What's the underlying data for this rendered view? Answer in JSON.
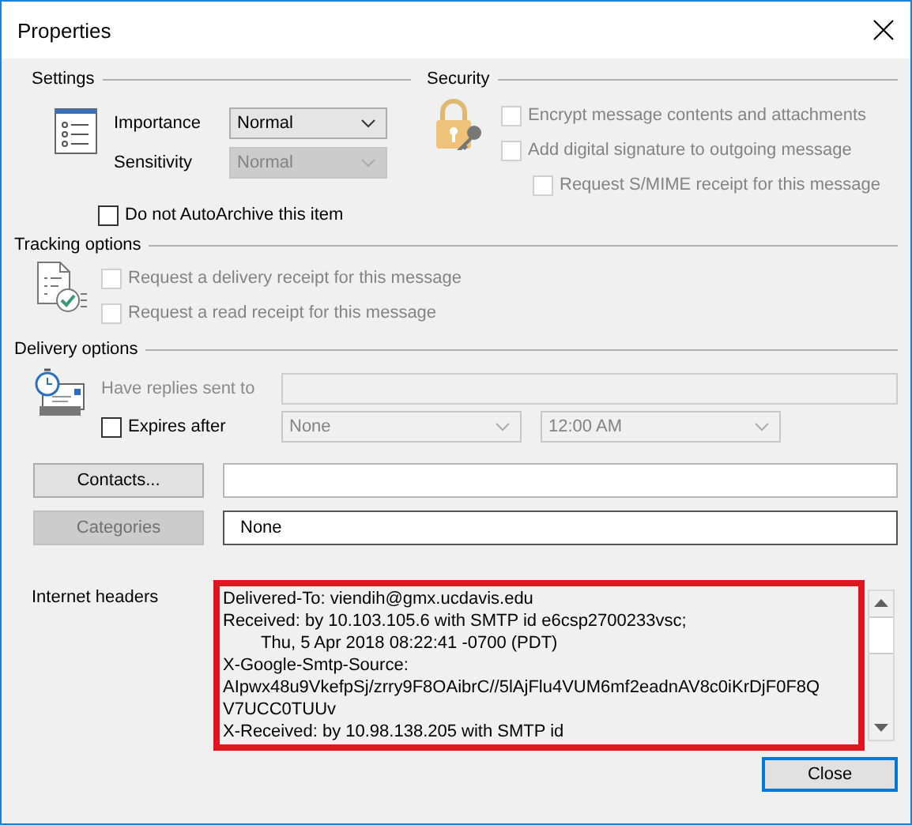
{
  "window": {
    "title": "Properties"
  },
  "settings": {
    "title": "Settings",
    "fields": [
      {
        "label": "Importance",
        "value": "Normal",
        "disabled": false
      },
      {
        "label": "Sensitivity",
        "value": "Normal",
        "disabled": true
      }
    ],
    "autoarchive": {
      "label": "Do not AutoArchive this item",
      "checked": false
    }
  },
  "security": {
    "title": "Security",
    "options": [
      {
        "label": "Encrypt message contents and attachments",
        "checked": false,
        "disabled": true,
        "indented": false
      },
      {
        "label": "Add digital signature to outgoing message",
        "checked": false,
        "disabled": true,
        "indented": false
      },
      {
        "label": "Request S/MIME receipt for this message",
        "checked": false,
        "disabled": true,
        "indented": true
      }
    ]
  },
  "tracking": {
    "title": "Tracking options",
    "options": [
      {
        "label": "Request a delivery receipt for this message",
        "checked": false,
        "disabled": true
      },
      {
        "label": "Request a read receipt for this message",
        "checked": false,
        "disabled": true
      }
    ]
  },
  "delivery": {
    "title": "Delivery options",
    "replies": {
      "label": "Have replies sent to",
      "disabled": true
    },
    "expires": {
      "label": "Expires after",
      "checked": false,
      "date": "None",
      "time": "12:00 AM",
      "disabled": true
    }
  },
  "contacts": {
    "button": "Contacts...",
    "disabled": false
  },
  "categories": {
    "button": "Categories",
    "disabled": true,
    "value": "None"
  },
  "headers": {
    "label": "Internet headers",
    "highlighted": true,
    "lines": [
      {
        "text": "Delivered-To: viendih@gmx.ucdavis.edu",
        "indented": false
      },
      {
        "text": "Received: by 10.103.105.6 with SMTP id e6csp2700233vsc;",
        "indented": false
      },
      {
        "text": "Thu, 5 Apr 2018 08:22:41 -0700 (PDT)",
        "indented": true
      },
      {
        "text": "X-Google-Smtp-Source:",
        "indented": false
      },
      {
        "text": "AIpwx48u9VkefpSj/zrry9F8OAibrC//5lAjFlu4VUM6mf2eadnAV8c0iKrDjF0F8Q",
        "indented": false
      },
      {
        "text": "V7UCC0TUUv",
        "indented": false
      },
      {
        "text": "X-Received: by 10.98.138.205 with SMTP id",
        "indented": false
      }
    ]
  },
  "buttons": [
    {
      "label": "Close",
      "default": true
    }
  ]
}
